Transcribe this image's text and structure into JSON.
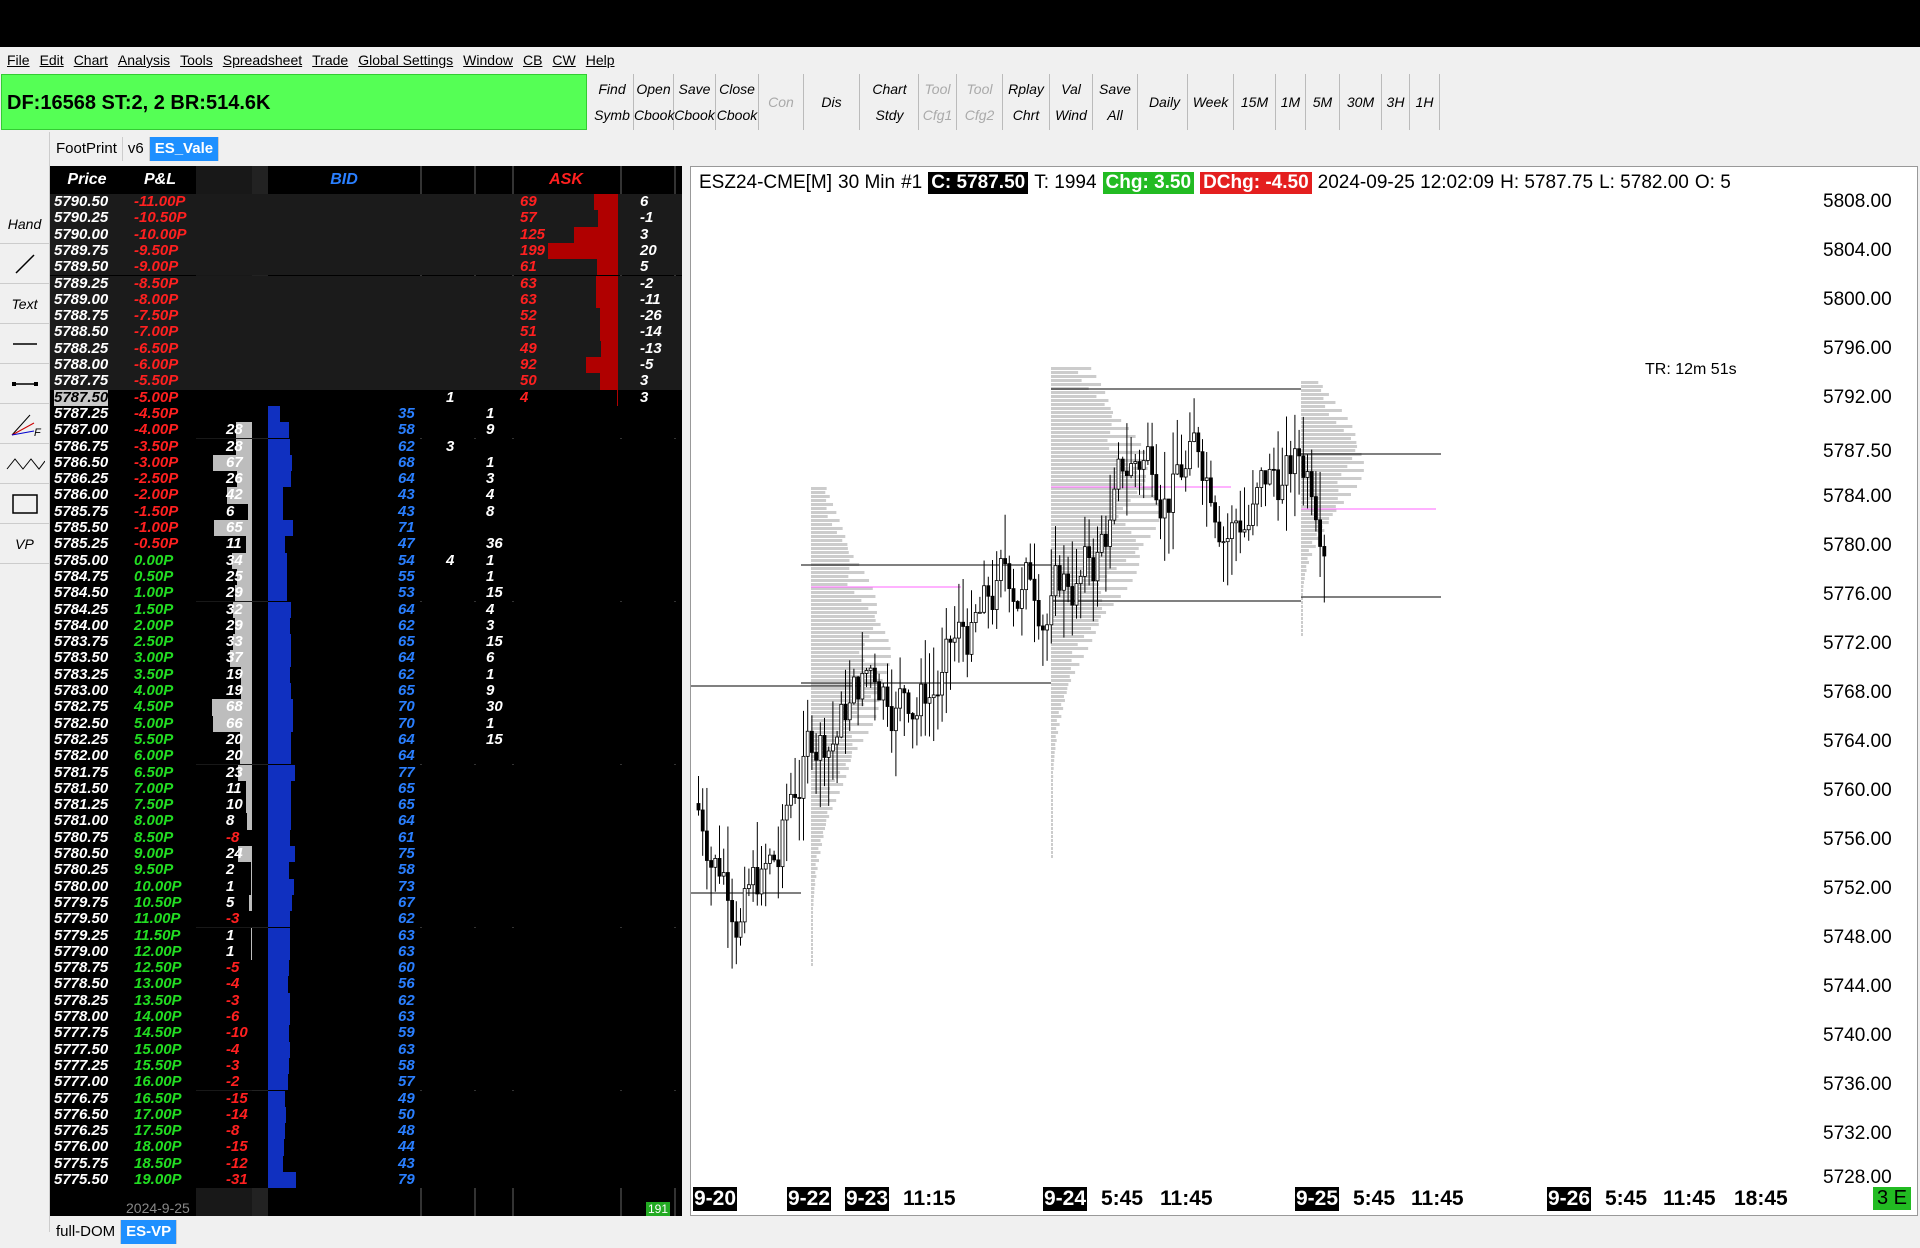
{
  "menu": [
    "File",
    "Edit",
    "Chart",
    "Analysis",
    "Tools",
    "Spreadsheet",
    "Trade",
    "Global Settings",
    "Window",
    "CB",
    "CW",
    "Help"
  ],
  "status_text": "DF:16568  ST:2, 2  BR:514.6K",
  "toolbar": {
    "buttons": [
      {
        "l1": "Find",
        "l2": "Symb"
      },
      {
        "l1": "Open",
        "l2": "Cbook"
      },
      {
        "l1": "Save",
        "l2": "Cbook"
      },
      {
        "l1": "Close",
        "l2": "Cbook"
      },
      {
        "l1": "Con",
        "l2": "",
        "disabled": true
      },
      {
        "l1": "Dis",
        "l2": ""
      },
      {
        "l1": "Chart",
        "l2": "Stdy"
      },
      {
        "l1": "Tool",
        "l2": "Cfg1",
        "disabled": true
      },
      {
        "l1": "Tool",
        "l2": "Cfg2",
        "disabled": true
      },
      {
        "l1": "Rplay",
        "l2": "Chrt"
      },
      {
        "l1": "Val",
        "l2": "Wind"
      },
      {
        "l1": "Save",
        "l2": "All"
      }
    ],
    "timeframes": [
      "Daily",
      "Week",
      "15M",
      "1M",
      "5M",
      "30M",
      "3H",
      "1H"
    ]
  },
  "top_tabs": [
    "FootPrint",
    "v6",
    "ES_Vale"
  ],
  "bottom_tabs": [
    "full-DOM",
    "ES-VP"
  ],
  "left_tools": [
    "Hand",
    "line-icon",
    "Text",
    "hline-icon",
    "ray-icon",
    "fib-icon",
    "wave-icon",
    "rect-icon",
    "VP"
  ],
  "dom": {
    "headers": {
      "price": "Price",
      "pnl": "P&L",
      "bid": "BID",
      "ask": "ASK"
    },
    "date_footer": "2024-9-25",
    "corner_badge": "191",
    "ask_rows": [
      {
        "price": "5790.50",
        "pnl": "-11.00P",
        "ask": "69",
        "delta": "6"
      },
      {
        "price": "5790.25",
        "pnl": "-10.50P",
        "ask": "57",
        "delta": "-1"
      },
      {
        "price": "5790.00",
        "pnl": "-10.00P",
        "ask": "125",
        "delta": "3"
      },
      {
        "price": "5789.75",
        "pnl": "-9.50P",
        "ask": "199",
        "delta": "20"
      },
      {
        "price": "5789.50",
        "pnl": "-9.00P",
        "ask": "61",
        "delta": "5"
      },
      {
        "price": "5789.25",
        "pnl": "-8.50P",
        "ask": "63",
        "delta": "-2"
      },
      {
        "price": "5789.00",
        "pnl": "-8.00P",
        "ask": "63",
        "delta": "-11"
      },
      {
        "price": "5788.75",
        "pnl": "-7.50P",
        "ask": "52",
        "delta": "-26"
      },
      {
        "price": "5788.50",
        "pnl": "-7.00P",
        "ask": "51",
        "delta": "-14"
      },
      {
        "price": "5788.25",
        "pnl": "-6.50P",
        "ask": "49",
        "delta": "-13"
      },
      {
        "price": "5788.00",
        "pnl": "-6.00P",
        "ask": "92",
        "delta": "-5"
      },
      {
        "price": "5787.75",
        "pnl": "-5.50P",
        "ask": "50",
        "delta": "3"
      },
      {
        "price": "5787.50",
        "pnl": "-5.00P",
        "ask": "4",
        "delta": "3",
        "c1": "1",
        "c2": "1"
      }
    ],
    "bid_rows": [
      {
        "price": "5787.25",
        "pnl": "-4.50P",
        "vol": "",
        "bid": "35",
        "c1": "",
        "c2": "1"
      },
      {
        "price": "5787.00",
        "pnl": "-4.00P",
        "vol": "28",
        "bid": "58",
        "c1": "",
        "c2": "9"
      },
      {
        "price": "5786.75",
        "pnl": "-3.50P",
        "vol": "28",
        "bid": "62",
        "c1": "3",
        "c2": ""
      },
      {
        "price": "5786.50",
        "pnl": "-3.00P",
        "vol": "67",
        "bid": "68",
        "c1": "",
        "c2": "1"
      },
      {
        "price": "5786.25",
        "pnl": "-2.50P",
        "vol": "26",
        "bid": "64",
        "c1": "",
        "c2": "3"
      },
      {
        "price": "5786.00",
        "pnl": "-2.00P",
        "vol": "42",
        "bid": "43",
        "c1": "",
        "c2": "4"
      },
      {
        "price": "5785.75",
        "pnl": "-1.50P",
        "vol": "6",
        "bid": "43",
        "c1": "",
        "c2": "8"
      },
      {
        "price": "5785.50",
        "pnl": "-1.00P",
        "vol": "65",
        "bid": "71",
        "c1": "",
        "c2": ""
      },
      {
        "price": "5785.25",
        "pnl": "-0.50P",
        "vol": "11",
        "bid": "47",
        "c1": "",
        "c2": "36"
      },
      {
        "price": "5785.00",
        "pnl": "0.00P",
        "vol": "34",
        "bid": "54",
        "c1": "4",
        "c2": "1"
      },
      {
        "price": "5784.75",
        "pnl": "0.50P",
        "vol": "25",
        "bid": "55",
        "c1": "",
        "c2": "1"
      },
      {
        "price": "5784.50",
        "pnl": "1.00P",
        "vol": "29",
        "bid": "53",
        "c1": "",
        "c2": "15"
      },
      {
        "price": "5784.25",
        "pnl": "1.50P",
        "vol": "32",
        "bid": "64",
        "c1": "",
        "c2": "4"
      },
      {
        "price": "5784.00",
        "pnl": "2.00P",
        "vol": "29",
        "bid": "62",
        "c1": "",
        "c2": "3"
      },
      {
        "price": "5783.75",
        "pnl": "2.50P",
        "vol": "33",
        "bid": "65",
        "c1": "",
        "c2": "15"
      },
      {
        "price": "5783.50",
        "pnl": "3.00P",
        "vol": "37",
        "bid": "64",
        "c1": "",
        "c2": "6"
      },
      {
        "price": "5783.25",
        "pnl": "3.50P",
        "vol": "19",
        "bid": "62",
        "c1": "",
        "c2": "1"
      },
      {
        "price": "5783.00",
        "pnl": "4.00P",
        "vol": "19",
        "bid": "65",
        "c1": "",
        "c2": "9"
      },
      {
        "price": "5782.75",
        "pnl": "4.50P",
        "vol": "68",
        "bid": "70",
        "c1": "",
        "c2": "30"
      },
      {
        "price": "5782.50",
        "pnl": "5.00P",
        "vol": "66",
        "bid": "70",
        "c1": "",
        "c2": "1"
      },
      {
        "price": "5782.25",
        "pnl": "5.50P",
        "vol": "20",
        "bid": "64",
        "c1": "",
        "c2": "15"
      },
      {
        "price": "5782.00",
        "pnl": "6.00P",
        "vol": "20",
        "bid": "64",
        "c1": "",
        "c2": ""
      },
      {
        "price": "5781.75",
        "pnl": "6.50P",
        "vol": "23",
        "bid": "77",
        "c1": "",
        "c2": ""
      },
      {
        "price": "5781.50",
        "pnl": "7.00P",
        "vol": "11",
        "bid": "65",
        "c1": "",
        "c2": ""
      },
      {
        "price": "5781.25",
        "pnl": "7.50P",
        "vol": "10",
        "bid": "65",
        "c1": "",
        "c2": ""
      },
      {
        "price": "5781.00",
        "pnl": "8.00P",
        "vol": "8",
        "bid": "64",
        "c1": "",
        "c2": ""
      },
      {
        "price": "5780.75",
        "pnl": "8.50P",
        "vol": "-8",
        "bid": "61",
        "c1": "",
        "c2": ""
      },
      {
        "price": "5780.50",
        "pnl": "9.00P",
        "vol": "24",
        "bid": "75",
        "c1": "",
        "c2": ""
      },
      {
        "price": "5780.25",
        "pnl": "9.50P",
        "vol": "2",
        "bid": "58",
        "c1": "",
        "c2": ""
      },
      {
        "price": "5780.00",
        "pnl": "10.00P",
        "vol": "1",
        "bid": "73",
        "c1": "",
        "c2": ""
      },
      {
        "price": "5779.75",
        "pnl": "10.50P",
        "vol": "5",
        "bid": "67",
        "c1": "",
        "c2": ""
      },
      {
        "price": "5779.50",
        "pnl": "11.00P",
        "vol": "-3",
        "bid": "62",
        "c1": "",
        "c2": ""
      },
      {
        "price": "5779.25",
        "pnl": "11.50P",
        "vol": "1",
        "bid": "63",
        "c1": "",
        "c2": ""
      },
      {
        "price": "5779.00",
        "pnl": "12.00P",
        "vol": "1",
        "bid": "63",
        "c1": "",
        "c2": ""
      },
      {
        "price": "5778.75",
        "pnl": "12.50P",
        "vol": "-5",
        "bid": "60",
        "c1": "",
        "c2": ""
      },
      {
        "price": "5778.50",
        "pnl": "13.00P",
        "vol": "-4",
        "bid": "56",
        "c1": "",
        "c2": ""
      },
      {
        "price": "5778.25",
        "pnl": "13.50P",
        "vol": "-3",
        "bid": "62",
        "c1": "",
        "c2": ""
      },
      {
        "price": "5778.00",
        "pnl": "14.00P",
        "vol": "-6",
        "bid": "63",
        "c1": "",
        "c2": ""
      },
      {
        "price": "5777.75",
        "pnl": "14.50P",
        "vol": "-10",
        "bid": "59",
        "c1": "",
        "c2": ""
      },
      {
        "price": "5777.50",
        "pnl": "15.00P",
        "vol": "-4",
        "bid": "63",
        "c1": "",
        "c2": ""
      },
      {
        "price": "5777.25",
        "pnl": "15.50P",
        "vol": "-3",
        "bid": "58",
        "c1": "",
        "c2": ""
      },
      {
        "price": "5777.00",
        "pnl": "16.00P",
        "vol": "-2",
        "bid": "57",
        "c1": "",
        "c2": ""
      },
      {
        "price": "5776.75",
        "pnl": "16.50P",
        "vol": "-15",
        "bid": "49",
        "c1": "",
        "c2": ""
      },
      {
        "price": "5776.50",
        "pnl": "17.00P",
        "vol": "-14",
        "bid": "50",
        "c1": "",
        "c2": ""
      },
      {
        "price": "5776.25",
        "pnl": "17.50P",
        "vol": "-8",
        "bid": "48",
        "c1": "",
        "c2": ""
      },
      {
        "price": "5776.00",
        "pnl": "18.00P",
        "vol": "-15",
        "bid": "44",
        "c1": "",
        "c2": ""
      },
      {
        "price": "5775.75",
        "pnl": "18.50P",
        "vol": "-12",
        "bid": "43",
        "c1": "",
        "c2": ""
      },
      {
        "price": "5775.50",
        "pnl": "19.00P",
        "vol": "-31",
        "bid": "79",
        "c1": "",
        "c2": ""
      }
    ]
  },
  "chart": {
    "symbol": "ESZ24-CME[M]",
    "interval": "30 Min",
    "num": "#1",
    "close": "C: 5787.50",
    "trades": "T: 1994",
    "chg": "Chg: 3.50",
    "dchg": "DChg: -4.50",
    "datetime": "2024-09-25 12:02:09",
    "high": "H: 5787.75",
    "low": "L: 5782.00",
    "open": "O: 5",
    "timer": "TR: 12m 51s",
    "y_ticks": [
      "5808.00",
      "5804.00",
      "5800.00",
      "5796.00",
      "5792.00",
      "5787.50",
      "5784.00",
      "5780.00",
      "5776.00",
      "5772.00",
      "5768.00",
      "5764.00",
      "5760.00",
      "5756.00",
      "5752.00",
      "5748.00",
      "5744.00",
      "5740.00",
      "5736.00",
      "5732.00",
      "5728.00"
    ],
    "x_labels": [
      {
        "t": "9-20",
        "box": true
      },
      {
        "t": "9-22",
        "box": true
      },
      {
        "t": "9-23",
        "box": true
      },
      {
        "t": "11:15",
        "box": false
      },
      {
        "t": "9-24",
        "box": true
      },
      {
        "t": "5:45",
        "box": false
      },
      {
        "t": "11:45",
        "box": false
      },
      {
        "t": "9-25",
        "box": true
      },
      {
        "t": "5:45",
        "box": false
      },
      {
        "t": "11:45",
        "box": false
      },
      {
        "t": "9-26",
        "box": true
      },
      {
        "t": "5:45",
        "box": false
      },
      {
        "t": "11:45",
        "box": false
      },
      {
        "t": "18:45",
        "box": false
      }
    ],
    "corner": "3 E",
    "colors": {
      "up": "#000000",
      "poc": "#ff66ff",
      "vp": "#cccccc"
    }
  }
}
